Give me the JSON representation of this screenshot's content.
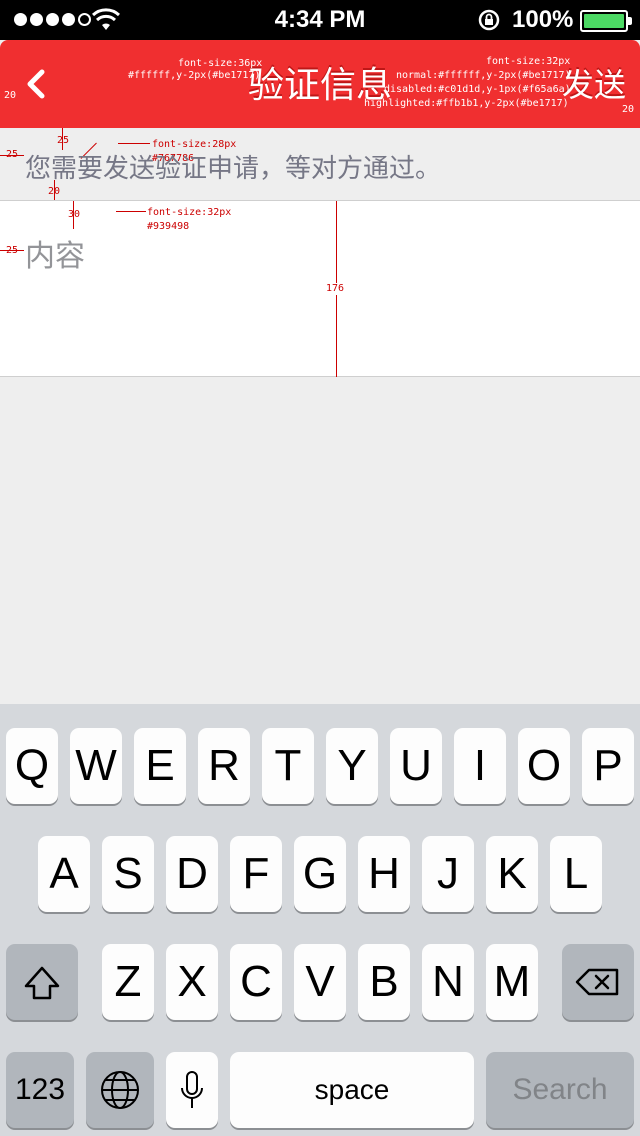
{
  "status_bar": {
    "time": "4:34 PM",
    "battery_percent": "100%",
    "signal_bars": 4,
    "signal_total": 5,
    "icons": [
      "signal-icon",
      "wifi-icon",
      "rotation-lock-icon",
      "battery-icon"
    ]
  },
  "navbar": {
    "title": "验证信息",
    "send_label": "发送",
    "back_icon": "chevron-left-icon",
    "background_color": "#f02f30",
    "annotations": {
      "title_spec": "font-size:36px",
      "title_color": "#ffffff,y-2px(#be1717)",
      "send_spec": "font-size:32px",
      "send_normal": "normal:#ffffff,y-2px(#be1717)",
      "send_disabled": "disabled:#c01d1d,y-1px(#f65a6a)",
      "send_highlighted": "highlighted:#ffb1b1,y-2px(#be1717)",
      "left_margin": "20",
      "right_margin": "20"
    }
  },
  "hint": {
    "text": "您需要发送验证申请，等对方通过。",
    "annotations": {
      "spec": "font-size:28px",
      "color": "#767786",
      "top_gap": "25",
      "left_gap": "25",
      "bottom_gap": "20"
    }
  },
  "content": {
    "placeholder": "内容",
    "annotations": {
      "spec": "font-size:32px",
      "color": "#939498",
      "top_gap": "30",
      "left_gap": "25",
      "height": "176"
    }
  },
  "keyboard": {
    "row1": [
      "Q",
      "W",
      "E",
      "R",
      "T",
      "Y",
      "U",
      "I",
      "O",
      "P"
    ],
    "row2": [
      "A",
      "S",
      "D",
      "F",
      "G",
      "H",
      "J",
      "K",
      "L"
    ],
    "row3": [
      "Z",
      "X",
      "C",
      "V",
      "B",
      "N",
      "M"
    ],
    "numbers_label": "123",
    "space_label": "space",
    "search_label": "Search"
  }
}
